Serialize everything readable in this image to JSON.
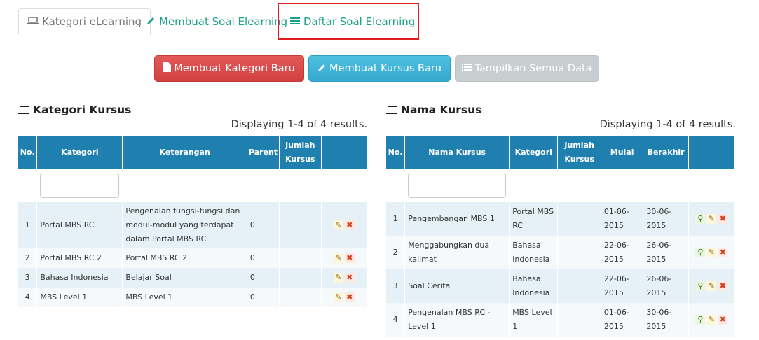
{
  "tabs": [
    {
      "label": "Kategori eLearning",
      "icon": "laptop-icon"
    },
    {
      "label": "Membuat Soal Elearning",
      "icon": "pencil-icon"
    },
    {
      "label": "Daftar Soal Elearning",
      "icon": "list-icon"
    }
  ],
  "buttons": {
    "new_category": "Membuat Kategori Baru",
    "new_course": "Membuat Kursus Baru",
    "show_all": "Tampilkan Semua Data"
  },
  "category_panel": {
    "title": "Kategori Kursus",
    "summary": "Displaying 1-4 of 4 results.",
    "headers": {
      "no": "No.",
      "kategori": "Kategori",
      "keterangan": "Keterangan",
      "parent": "Parent",
      "jumlah": "Jumlah Kursus"
    },
    "rows": [
      {
        "no": "1",
        "kategori": "Portal MBS RC",
        "keterangan": "Pengenalan fungsi-fungsi dan modul-modul yang  terdapat dalam Portal MBS RC",
        "parent": "0",
        "jumlah": ""
      },
      {
        "no": "2",
        "kategori": "Portal MBS RC 2",
        "keterangan": "Portal MBS RC 2",
        "parent": "0",
        "jumlah": ""
      },
      {
        "no": "3",
        "kategori": "Bahasa Indonesia",
        "keterangan": "Belajar Soal",
        "parent": "0",
        "jumlah": ""
      },
      {
        "no": "4",
        "kategori": "MBS Level 1",
        "keterangan": "MBS Level 1",
        "parent": "0",
        "jumlah": ""
      }
    ]
  },
  "course_panel": {
    "title": "Nama Kursus",
    "summary": "Displaying 1-4 of 4 results.",
    "headers": {
      "no": "No.",
      "nama": "Nama Kursus",
      "kategori": "Kategori",
      "jumlah": "Jumlah Kursus",
      "mulai": "Mulai",
      "berakhir": "Berakhir"
    },
    "rows": [
      {
        "no": "1",
        "nama": "Pengembangan MBS 1",
        "kategori": "Portal MBS RC",
        "jumlah": "",
        "mulai": "01-06-2015",
        "berakhir": "30-06-2015"
      },
      {
        "no": "2",
        "nama": "Menggabungkan dua kalimat",
        "kategori": "Bahasa Indonesia",
        "jumlah": "",
        "mulai": "22-06-2015",
        "berakhir": "26-06-2015"
      },
      {
        "no": "3",
        "nama": "Soal Cerita",
        "kategori": "Bahasa Indonesia",
        "jumlah": "",
        "mulai": "22-06-2015",
        "berakhir": "26-06-2015"
      },
      {
        "no": "4",
        "nama": "Pengenalan MBS RC - Level 1",
        "kategori": "MBS Level 1",
        "jumlah": "",
        "mulai": "01-06-2015",
        "berakhir": "30-06-2015"
      }
    ]
  },
  "colors": {
    "accent": "#1aa089",
    "header_bg": "#1f7fae",
    "btn_red": "#d9534f",
    "btn_blue": "#46b8da",
    "btn_gray": "#c8cdd0",
    "highlight": "#e02020"
  }
}
